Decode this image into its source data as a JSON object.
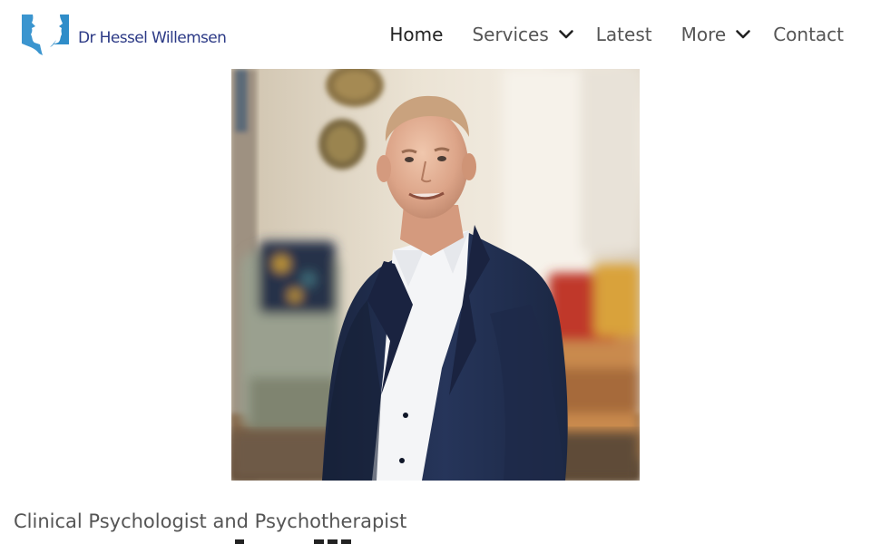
{
  "site": {
    "name": "Dr Hessel Willemsen",
    "logo_icon": "profile-silhouette-logo",
    "brand_text_color": "#2c3a86",
    "brand_accent_color": "#3b95cf"
  },
  "nav": {
    "items": [
      {
        "label": "Home",
        "active": true,
        "dropdown": false
      },
      {
        "label": "Services",
        "active": false,
        "dropdown": true,
        "icon": "chevron-down-icon"
      },
      {
        "label": "Latest",
        "active": false,
        "dropdown": false
      },
      {
        "label": "More",
        "active": false,
        "dropdown": true,
        "icon": "chevron-down-icon"
      },
      {
        "label": "Contact",
        "active": false,
        "dropdown": false
      }
    ]
  },
  "hero": {
    "image": "portrait-photo",
    "subject": "smiling man in navy suit jacket and white shirt seated in a warmly lit room"
  },
  "intro": {
    "tagline": "Clinical Psychologist and Psychotherapist"
  }
}
